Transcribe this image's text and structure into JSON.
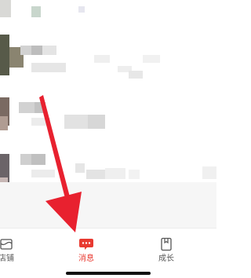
{
  "tabbar": {
    "tabs": [
      {
        "label": "店铺",
        "icon": "store-icon"
      },
      {
        "label": "消息",
        "icon": "message-icon",
        "active": true
      },
      {
        "label": "成长",
        "icon": "bookmark-icon"
      }
    ]
  },
  "colors": {
    "accent": "#e83a31",
    "arrow": "#e8212f",
    "tab_label": "#555555"
  }
}
